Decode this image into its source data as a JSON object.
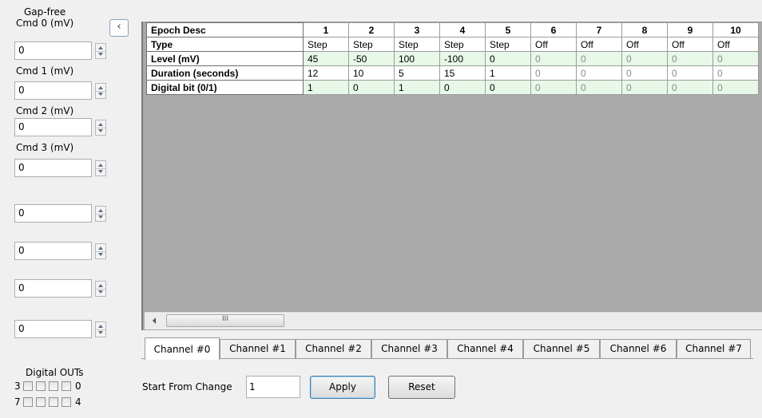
{
  "left_panel": {
    "title": "Gap-free",
    "commands": [
      {
        "label": "Cmd 0 (mV)",
        "value": "0"
      },
      {
        "label": "Cmd 1 (mV)",
        "value": "0"
      },
      {
        "label": "Cmd 2 (mV)",
        "value": "0"
      },
      {
        "label": "Cmd 3 (mV)",
        "value": "0"
      }
    ],
    "extra_values": [
      "0",
      "0",
      "0",
      "0"
    ],
    "digital_outs": {
      "title": "Digital OUTs",
      "row1_left": "3",
      "row1_right": "0",
      "row2_left": "7",
      "row2_right": "4"
    },
    "collapse_glyph": "‹"
  },
  "grid": {
    "columns": [
      "Epoch Desc",
      "1",
      "2",
      "3",
      "4",
      "5",
      "6",
      "7",
      "8",
      "9",
      "10"
    ],
    "rows": [
      {
        "label": "Type",
        "cells": [
          "Step",
          "Step",
          "Step",
          "Step",
          "Step",
          "Off",
          "Off",
          "Off",
          "Off",
          "Off"
        ]
      },
      {
        "label": "Level (mV)",
        "cells": [
          "45",
          "-50",
          "100",
          "-100",
          "0",
          "0",
          "0",
          "0",
          "0",
          "0"
        ]
      },
      {
        "label": "Duration (seconds)",
        "cells": [
          "12",
          "10",
          "5",
          "15",
          "1",
          "0",
          "0",
          "0",
          "0",
          "0"
        ]
      },
      {
        "label": "Digital bit (0/1)",
        "cells": [
          "1",
          "0",
          "1",
          "0",
          "0",
          "0",
          "0",
          "0",
          "0",
          "0"
        ]
      }
    ],
    "scroll_thumb_glyph": "III"
  },
  "tabs": [
    "Channel #0",
    "Channel #1",
    "Channel #2",
    "Channel #3",
    "Channel #4",
    "Channel #5",
    "Channel #6",
    "Channel #7"
  ],
  "bottom": {
    "start_label": "Start From Change",
    "start_value": "1",
    "apply_label": "Apply",
    "reset_label": "Reset"
  },
  "colors": {
    "window_bg": "#f0f0f0",
    "grid_bg": "#aaaaaa",
    "editable_row": "#e8f8e8",
    "disabled_text": "#8a8a8a"
  },
  "icons": [
    "chevron-left-icon",
    "spin-up-icon",
    "spin-down-icon",
    "scroll-left-icon"
  ]
}
